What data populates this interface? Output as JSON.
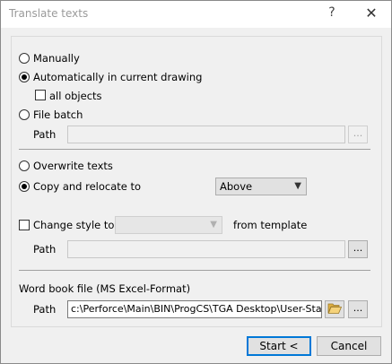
{
  "window": {
    "title": "Translate texts",
    "help_glyph": "?",
    "close_glyph": "✕"
  },
  "mode": {
    "manual_label": "Manually",
    "auto_label": "Automatically in current drawing",
    "all_objects_label": "all objects",
    "batch_label": "File batch",
    "selected": "auto"
  },
  "batch": {
    "path_label": "Path",
    "browse_label": "..."
  },
  "output": {
    "overwrite_label": "Overwrite texts",
    "copy_label": "Copy and relocate to",
    "selected": "copy",
    "relocate_value": "Above"
  },
  "style": {
    "change_label": "Change style to",
    "style_value": "",
    "from_template_label": "from template",
    "path_label": "Path",
    "browse_label": "..."
  },
  "wordbook": {
    "group_label": "Word book file (MS Excel-Format)",
    "path_label": "Path",
    "path_value": "c:\\Perforce\\Main\\BIN\\ProgCS\\TGA Desktop\\User-Standard",
    "open_icon": "folder-open-icon",
    "browse_label": "..."
  },
  "buttons": {
    "start_label": "Start <",
    "cancel_label": "Cancel"
  },
  "colors": {
    "default_button_border": "#0078d7",
    "window_bg": "#f0f0f0",
    "title_text": "#9a9a9a"
  }
}
